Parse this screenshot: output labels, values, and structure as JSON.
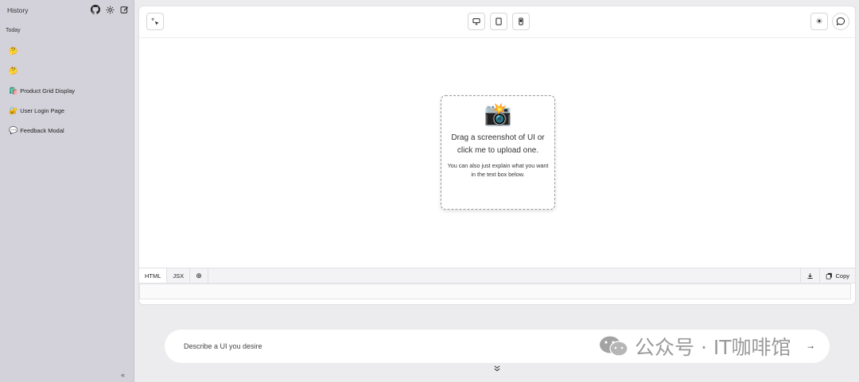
{
  "sidebar": {
    "title": "History",
    "section": "Today",
    "items": [
      {
        "emoji": "🤔",
        "label": ""
      },
      {
        "emoji": "🤔",
        "label": ""
      },
      {
        "emoji": "🛍️",
        "label": "Product Grid Display"
      },
      {
        "emoji": "🔐",
        "label": "User Login Page"
      },
      {
        "emoji": "💬",
        "label": "Feedback Modal"
      }
    ],
    "collapse_glyph": "«"
  },
  "toolbar": {
    "select_icon": "cursor-click-icon",
    "devices": [
      "desktop-icon",
      "tablet-icon",
      "mobile-icon"
    ],
    "theme_glyph": "☀",
    "chat_icon": "chat-bubble-icon"
  },
  "upload": {
    "emoji": "📸",
    "title": "Drag a screenshot of UI or click me to upload one.",
    "subtitle": "You can also just explain what you want in the text box below."
  },
  "tabs": {
    "items": [
      "HTML",
      "JSX"
    ],
    "add_glyph": "⊕",
    "copy_label": "Copy"
  },
  "prompt": {
    "placeholder": "Describe a UI you desire",
    "send_glyph": "→"
  },
  "watermark": "公众号 · IT咖啡馆",
  "expand_glyph": "⌄⌄"
}
